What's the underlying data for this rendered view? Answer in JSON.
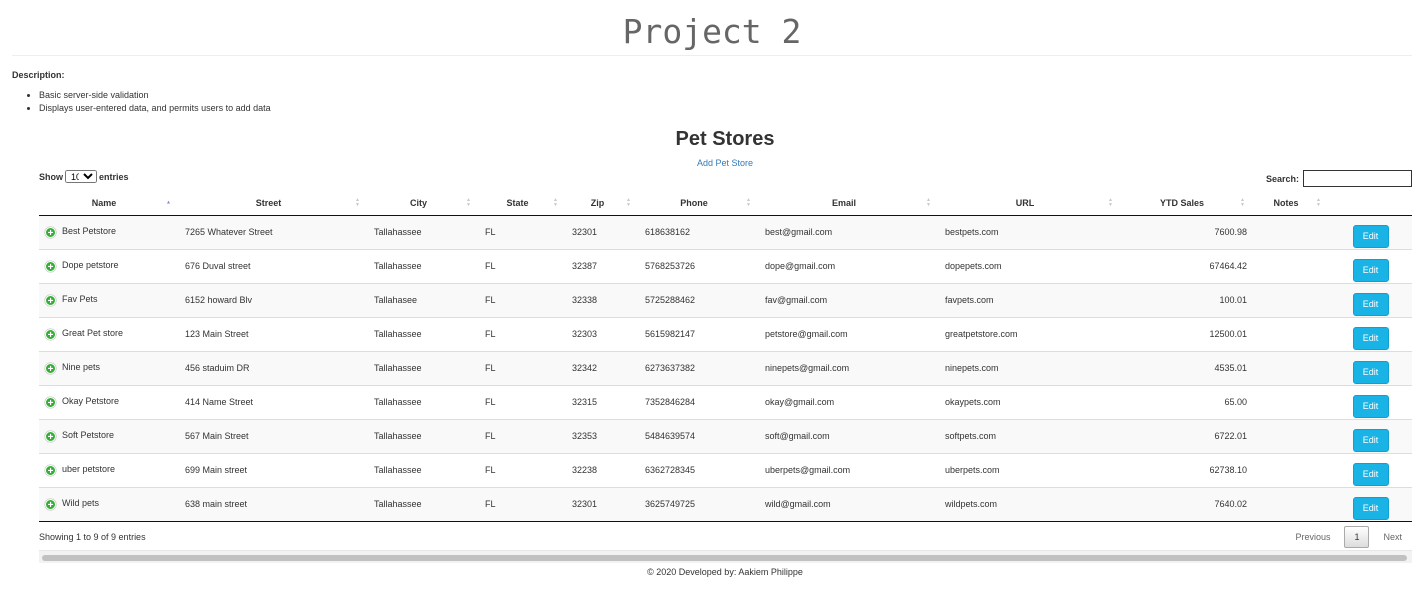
{
  "header": {
    "title": "Project 2"
  },
  "description": {
    "label": "Description:",
    "items": [
      "Basic server-side validation",
      "Displays user-entered data, and permits users to add data"
    ]
  },
  "section": {
    "title": "Pet Stores",
    "add_link": "Add Pet Store"
  },
  "controls": {
    "show_label": "Show",
    "entries_value": "10",
    "entries_label": "entries",
    "search_label": "Search:",
    "search_value": ""
  },
  "table": {
    "columns": [
      "Name",
      "Street",
      "City",
      "State",
      "Zip",
      "Phone",
      "Email",
      "URL",
      "YTD Sales",
      "Notes",
      ""
    ],
    "edit_label": "Edit",
    "rows": [
      {
        "name": "Best Petstore",
        "street": "7265 Whatever Street",
        "city": "Tallahassee",
        "state": "FL",
        "zip": "32301",
        "phone": "618638162",
        "email": "best@gmail.com",
        "url": "bestpets.com",
        "sales": "7600.98",
        "notes": ""
      },
      {
        "name": "Dope petstore",
        "street": "676 Duval street",
        "city": "Tallahassee",
        "state": "FL",
        "zip": "32387",
        "phone": "5768253726",
        "email": "dope@gmail.com",
        "url": "dopepets.com",
        "sales": "67464.42",
        "notes": ""
      },
      {
        "name": "Fav Pets",
        "street": "6152 howard Blv",
        "city": "Tallahasee",
        "state": "FL",
        "zip": "32338",
        "phone": "5725288462",
        "email": "fav@gmail.com",
        "url": "favpets.com",
        "sales": "100.01",
        "notes": ""
      },
      {
        "name": "Great Pet store",
        "street": "123 Main Street",
        "city": "Tallahassee",
        "state": "FL",
        "zip": "32303",
        "phone": "5615982147",
        "email": "petstore@gmail.com",
        "url": "greatpetstore.com",
        "sales": "12500.01",
        "notes": ""
      },
      {
        "name": "Nine pets",
        "street": "456 staduim DR",
        "city": "Tallahassee",
        "state": "FL",
        "zip": "32342",
        "phone": "6273637382",
        "email": "ninepets@gmail.com",
        "url": "ninepets.com",
        "sales": "4535.01",
        "notes": ""
      },
      {
        "name": "Okay Petstore",
        "street": "414 Name Street",
        "city": "Tallahassee",
        "state": "FL",
        "zip": "32315",
        "phone": "7352846284",
        "email": "okay@gmail.com",
        "url": "okaypets.com",
        "sales": "65.00",
        "notes": ""
      },
      {
        "name": "Soft Petstore",
        "street": "567 Main Street",
        "city": "Tallahassee",
        "state": "FL",
        "zip": "32353",
        "phone": "5484639574",
        "email": "soft@gmail.com",
        "url": "softpets.com",
        "sales": "6722.01",
        "notes": ""
      },
      {
        "name": "uber petstore",
        "street": "699 Main street",
        "city": "Tallahassee",
        "state": "FL",
        "zip": "32238",
        "phone": "6362728345",
        "email": "uberpets@gmail.com",
        "url": "uberpets.com",
        "sales": "62738.10",
        "notes": ""
      },
      {
        "name": "Wild pets",
        "street": "638 main street",
        "city": "Tallahassee",
        "state": "FL",
        "zip": "32301",
        "phone": "3625749725",
        "email": "wild@gmail.com",
        "url": "wildpets.com",
        "sales": "7640.02",
        "notes": ""
      }
    ]
  },
  "table_info": "Showing 1 to 9 of 9 entries",
  "pagination": {
    "previous": "Previous",
    "current": "1",
    "next": "Next"
  },
  "footer": "© 2020 Developed by: Aakiem Philippe",
  "colors": {
    "link": "#337ab7",
    "edit_button": "#1ab3e6",
    "expand_icon": "#31b131"
  }
}
